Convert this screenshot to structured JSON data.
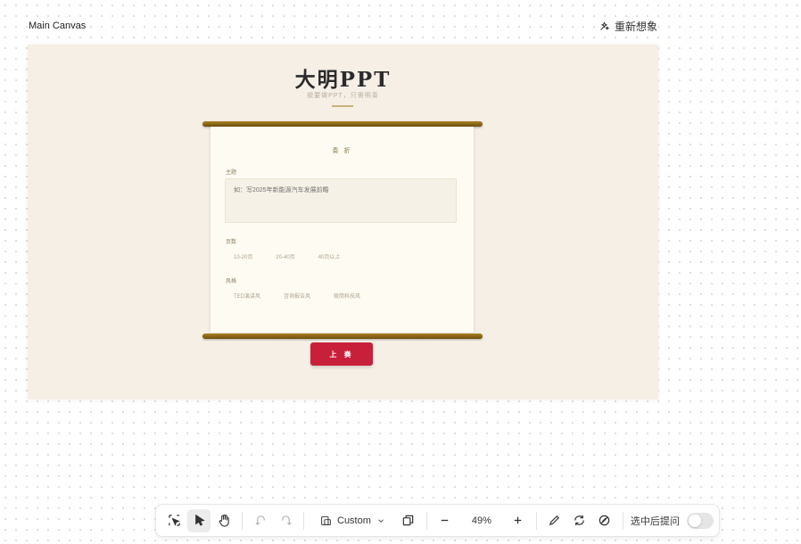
{
  "canvas": {
    "title": "Main Canvas",
    "reimagine_label": "重新想象"
  },
  "ppt": {
    "title": "大明PPT",
    "subtitle": "欲要做PPT，只需明奏"
  },
  "scroll": {
    "heading": "奏 折",
    "topic_label": "主题",
    "topic_placeholder": "如：写2025年新能源汽车发展前瞻",
    "pages_label": "页数",
    "page_options": [
      "10-20页",
      "20-40页",
      "40页以上"
    ],
    "style_label": "风格",
    "style_options": [
      "TED演讲风",
      "咨询报告风",
      "极简科技风"
    ],
    "submit_label": "上 奏"
  },
  "toolbar": {
    "preset_label": "Custom",
    "zoom_label": "49%",
    "toggle_label": "选中后提问",
    "toggle_on": false,
    "icons": [
      "lasso-select-icon",
      "pointer-icon",
      "hand-icon",
      "undo-icon",
      "redo-icon",
      "frame-icon",
      "chevron-down-icon",
      "duplicate-icon",
      "zoom-out-icon",
      "zoom-in-icon",
      "pencil-icon",
      "refresh-icon",
      "disable-icon"
    ]
  },
  "colors": {
    "artboard": "#f5efe6",
    "submit": "#c81f3a",
    "rod": "#8b6514"
  }
}
